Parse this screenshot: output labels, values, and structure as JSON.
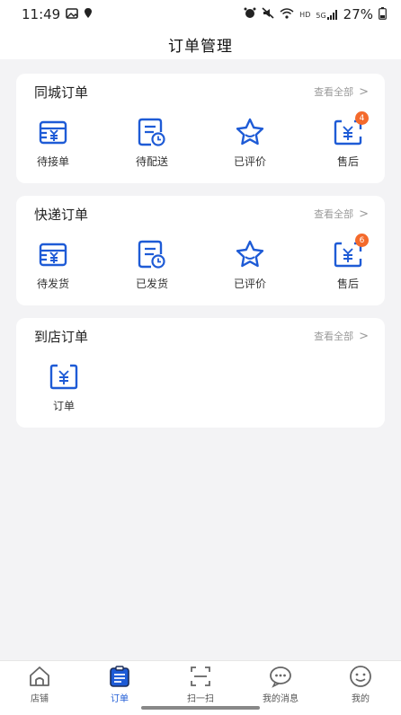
{
  "status_bar": {
    "time": "11:49",
    "network": "HD",
    "signal": "5G",
    "battery": "27%"
  },
  "header": {
    "title": "订单管理"
  },
  "sections": [
    {
      "title": "同城订单",
      "see_all": "查看全部",
      "items": [
        {
          "label": "待接单",
          "icon": "wallet-yuan-icon"
        },
        {
          "label": "待配送",
          "icon": "document-clock-icon"
        },
        {
          "label": "已评价",
          "icon": "star-icon"
        },
        {
          "label": "售后",
          "icon": "yuan-refund-icon",
          "badge": "4"
        }
      ]
    },
    {
      "title": "快递订单",
      "see_all": "查看全部",
      "items": [
        {
          "label": "待发货",
          "icon": "wallet-yuan-icon"
        },
        {
          "label": "已发货",
          "icon": "document-clock-icon"
        },
        {
          "label": "已评价",
          "icon": "star-icon"
        },
        {
          "label": "售后",
          "icon": "yuan-refund-icon",
          "badge": "6"
        }
      ]
    },
    {
      "title": "到店订单",
      "see_all": "查看全部",
      "items": [
        {
          "label": "订单",
          "icon": "yuan-order-icon"
        }
      ]
    }
  ],
  "bottom_nav": [
    {
      "label": "店铺",
      "icon": "shop-icon",
      "active": false
    },
    {
      "label": "订单",
      "icon": "order-icon",
      "active": true
    },
    {
      "label": "扫一扫",
      "icon": "scan-icon",
      "active": false
    },
    {
      "label": "我的消息",
      "icon": "message-icon",
      "active": false
    },
    {
      "label": "我的",
      "icon": "profile-icon",
      "active": false
    }
  ],
  "colors": {
    "accent": "#1e5bd6",
    "badge": "#f46a2c",
    "background": "#f3f3f5"
  }
}
